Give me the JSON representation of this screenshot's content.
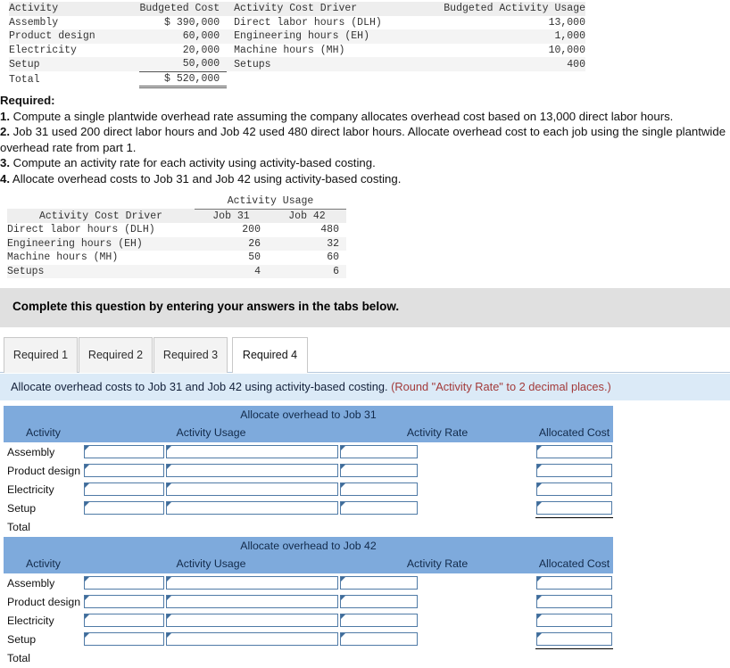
{
  "budget_table": {
    "headers": [
      "Activity",
      "Budgeted Cost",
      "Activity Cost Driver",
      "Budgeted Activity Usage"
    ],
    "rows": [
      {
        "activity": "Assembly",
        "cost": "$ 390,000",
        "driver": "Direct labor hours (DLH)",
        "usage": "13,000"
      },
      {
        "activity": "Product design",
        "cost": "60,000",
        "driver": "Engineering hours (EH)",
        "usage": "1,000"
      },
      {
        "activity": "Electricity",
        "cost": "20,000",
        "driver": "Machine hours (MH)",
        "usage": "10,000"
      },
      {
        "activity": "Setup",
        "cost": "50,000",
        "driver": "Setups",
        "usage": "400"
      }
    ],
    "total_label": "Total",
    "total_cost": "$ 520,000"
  },
  "required": {
    "title": "Required:",
    "items": [
      {
        "num": "1.",
        "text": " Compute a single plantwide overhead rate assuming the company allocates overhead cost based on 13,000 direct labor hours."
      },
      {
        "num": "2.",
        "text": " Job 31 used 200 direct labor hours and Job 42 used 480 direct labor hours. Allocate overhead cost to each job using the single plantwide overhead rate from part 1."
      },
      {
        "num": "3.",
        "text": " Compute an activity rate for each activity using activity-based costing."
      },
      {
        "num": "4.",
        "text": " Allocate overhead costs to Job 31 and Job 42 using activity-based costing."
      }
    ]
  },
  "usage_table": {
    "group_header": "Activity Usage",
    "driver_header": "Activity Cost Driver",
    "job31_header": "Job 31",
    "job42_header": "Job 42",
    "rows": [
      {
        "driver": "Direct labor hours (DLH)",
        "job31": "200",
        "job42": "480"
      },
      {
        "driver": "Engineering hours (EH)",
        "job31": "26",
        "job42": "32"
      },
      {
        "driver": "Machine hours (MH)",
        "job31": "50",
        "job42": "60"
      },
      {
        "driver": "Setups",
        "job31": "4",
        "job42": "6"
      }
    ]
  },
  "callout": {
    "text": "Complete this question by entering your answers in the tabs below."
  },
  "tabs": {
    "items": [
      {
        "label": "Required 1",
        "active": false
      },
      {
        "label": "Required 2",
        "active": false
      },
      {
        "label": "Required 3",
        "active": false
      },
      {
        "label": "Required 4",
        "active": true
      }
    ]
  },
  "instruction": {
    "main": "Allocate overhead costs to Job 31 and Job 42 using activity-based costing.",
    "note": "(Round \"Activity Rate\" to 2 decimal places.)"
  },
  "answer_grids": [
    {
      "title": "Allocate overhead to Job 31",
      "columns": [
        "Activity",
        "Activity Usage",
        "Activity Rate",
        "Allocated Cost"
      ],
      "rows": [
        "Assembly",
        "Product design",
        "Electricity",
        "Setup"
      ],
      "total_label": "Total"
    },
    {
      "title": "Allocate overhead to Job 42",
      "columns": [
        "Activity",
        "Activity Usage",
        "Activity Rate",
        "Allocated Cost"
      ],
      "rows": [
        "Assembly",
        "Product design",
        "Electricity",
        "Setup"
      ],
      "total_label": "Total"
    }
  ],
  "colors": {
    "header_blue": "#7eaadc",
    "instruction_blue": "#dbeaf7",
    "callout_gray": "#e0e0e0",
    "note_red": "#a33a3a",
    "input_border": "#4f7aa6"
  }
}
